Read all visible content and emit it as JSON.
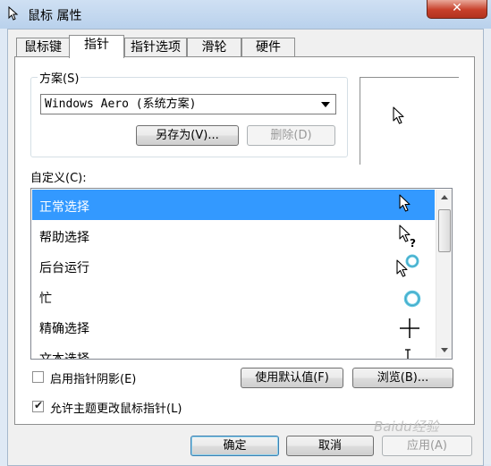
{
  "window": {
    "title": "鼠标 属性",
    "close_label": "✕"
  },
  "tabs": [
    {
      "label": "鼠标键"
    },
    {
      "label": "指针"
    },
    {
      "label": "指针选项"
    },
    {
      "label": "滑轮"
    },
    {
      "label": "硬件"
    }
  ],
  "scheme": {
    "group_label": "方案(S)",
    "selected": "Windows Aero (系统方案)",
    "save_as_label": "另存为(V)...",
    "delete_label": "删除(D)"
  },
  "customize": {
    "label": "自定义(C):",
    "rows": [
      {
        "label": "正常选择",
        "icon": "arrow-cursor-icon"
      },
      {
        "label": "帮助选择",
        "icon": "help-cursor-icon"
      },
      {
        "label": "后台运行",
        "icon": "working-in-background-cursor-icon"
      },
      {
        "label": "忙",
        "icon": "busy-cursor-icon"
      },
      {
        "label": "精确选择",
        "icon": "crosshair-cursor-icon"
      },
      {
        "label": "文本选择",
        "icon": "text-select-cursor-icon"
      }
    ]
  },
  "options": {
    "shadow_label": "启用指针阴影(E)",
    "shadow_checked": false,
    "use_default_label": "使用默认值(F)",
    "browse_label": "浏览(B)...",
    "allow_theme_label": "允许主题更改鼠标指针(L)",
    "allow_theme_checked": true
  },
  "footer": {
    "ok_label": "确定",
    "cancel_label": "取消",
    "apply_label": "应用(A)"
  },
  "watermark_text": "Baidu经验",
  "colors": {
    "selection": "#3399ff",
    "close": "#c7402a"
  }
}
